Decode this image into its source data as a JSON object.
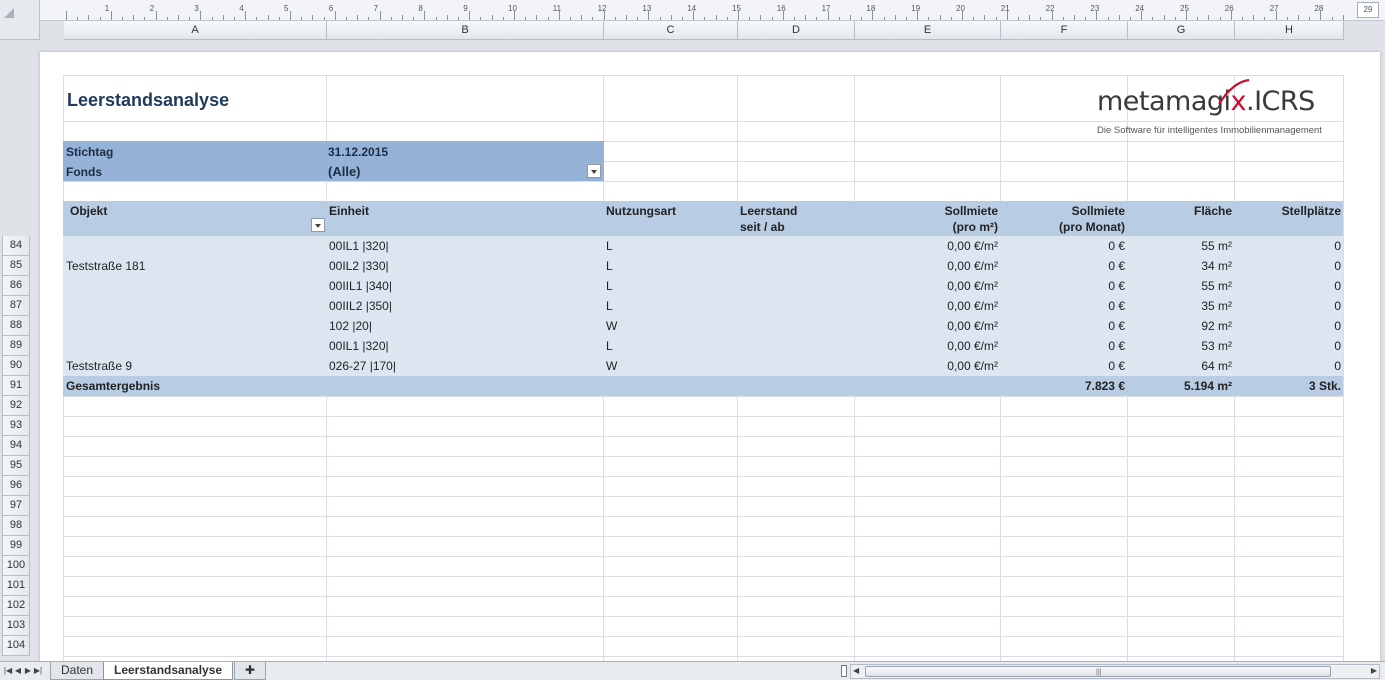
{
  "ruler": {
    "numbers": [
      "1",
      "2",
      "3",
      "4",
      "5",
      "6",
      "7",
      "8",
      "9",
      "10",
      "11",
      "12",
      "13",
      "14",
      "15",
      "16",
      "17",
      "18",
      "19",
      "20",
      "21",
      "22",
      "23",
      "24",
      "25",
      "26",
      "27",
      "28",
      "29"
    ]
  },
  "columns": [
    "A",
    "B",
    "C",
    "D",
    "E",
    "F",
    "G",
    "H"
  ],
  "rows": [
    "84",
    "85",
    "86",
    "87",
    "88",
    "89",
    "90",
    "91",
    "92",
    "93",
    "94",
    "95",
    "96",
    "97",
    "98",
    "99",
    "100",
    "101",
    "102",
    "103",
    "104"
  ],
  "report": {
    "title": "Leerstandsanalyse",
    "logo_word": "metamagi",
    "logo_x": "x",
    "logo_suffix": ".ICRS",
    "logo_tagline": "Die Software für intelligentes Immobilienmanagement"
  },
  "filters": {
    "stichtag_label": "Stichtag",
    "stichtag_value": "31.12.2015",
    "fonds_label": "Fonds",
    "fonds_value": "(Alle)"
  },
  "table": {
    "headers": {
      "objekt": "Objekt",
      "einheit": "Einheit",
      "nutzungsart": "Nutzungsart",
      "leerstand_1": "Leerstand",
      "leerstand_2": "seit / ab",
      "sollmiete_m2_1": "Sollmiete",
      "sollmiete_m2_2": "(pro m²)",
      "sollmiete_monat_1": "Sollmiete",
      "sollmiete_monat_2": "(pro Monat)",
      "flaeche": "Fläche",
      "stellplaetze": "Stellplätze"
    },
    "rows": [
      {
        "objekt": "",
        "einheit": "00IL1 |320|",
        "nutzungsart": "L",
        "leerstand": "",
        "miete_m2": "0,00 €/m²",
        "miete_monat": "0 €",
        "flaeche": "55 m²",
        "stellplaetze": "0"
      },
      {
        "objekt": "Teststraße 181",
        "einheit": "00IL2 |330|",
        "nutzungsart": "L",
        "leerstand": "",
        "miete_m2": "0,00 €/m²",
        "miete_monat": "0 €",
        "flaeche": "34 m²",
        "stellplaetze": "0"
      },
      {
        "objekt": "",
        "einheit": "00IIL1 |340|",
        "nutzungsart": "L",
        "leerstand": "",
        "miete_m2": "0,00 €/m²",
        "miete_monat": "0 €",
        "flaeche": "55 m²",
        "stellplaetze": "0"
      },
      {
        "objekt": "",
        "einheit": "00IIL2 |350|",
        "nutzungsart": "L",
        "leerstand": "",
        "miete_m2": "0,00 €/m²",
        "miete_monat": "0 €",
        "flaeche": "35 m²",
        "stellplaetze": "0"
      },
      {
        "objekt": "",
        "einheit": "102 |20|",
        "nutzungsart": "W",
        "leerstand": "",
        "miete_m2": "0,00 €/m²",
        "miete_monat": "0 €",
        "flaeche": "92 m²",
        "stellplaetze": "0"
      },
      {
        "objekt": "",
        "einheit": "00IL1 |320|",
        "nutzungsart": "L",
        "leerstand": "",
        "miete_m2": "0,00 €/m²",
        "miete_monat": "0 €",
        "flaeche": "53 m²",
        "stellplaetze": "0"
      },
      {
        "objekt": "Teststraße 9",
        "einheit": "026-27 |170|",
        "nutzungsart": "W",
        "leerstand": "",
        "miete_m2": "0,00 €/m²",
        "miete_monat": "0 €",
        "flaeche": "64 m²",
        "stellplaetze": "0"
      }
    ],
    "total": {
      "label": "Gesamtergebnis",
      "miete_monat": "7.823 €",
      "flaeche": "5.194 m²",
      "stellplaetze": "3 Stk."
    }
  },
  "sheet_tabs": {
    "tab1": "Daten",
    "tab2": "Leerstandsanalyse"
  },
  "colors": {
    "filter_bg": "#95b3d7",
    "header_bg": "#b8cce4",
    "data_bg": "#dce6f1",
    "title": "#1f3b5c",
    "logo_accent": "#c8102e"
  }
}
